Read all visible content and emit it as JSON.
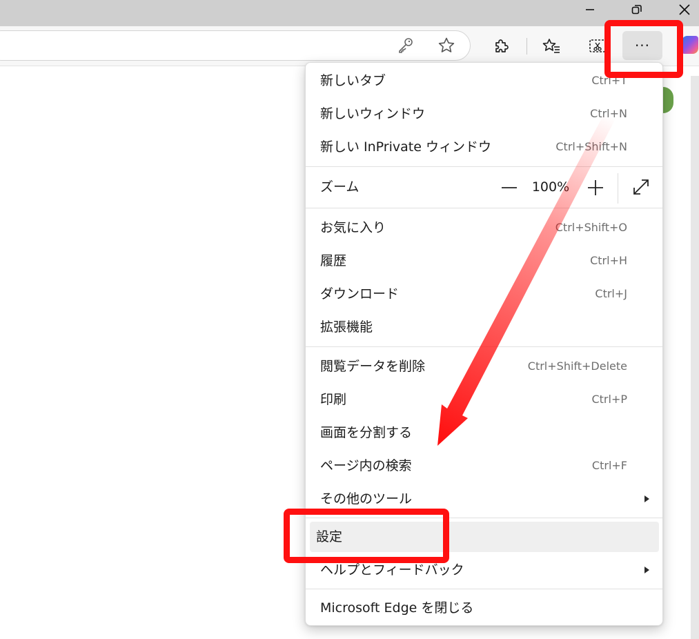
{
  "window_controls": {
    "minimize_icon": "minimize-icon",
    "restore_icon": "restore-icon",
    "close_icon": "close-icon"
  },
  "toolbar": {
    "more_label": "···",
    "icons": [
      "key-icon",
      "favorite-star-icon",
      "extensions-icon",
      "favorites-list-icon",
      "screenshot-icon",
      "copilot-icon"
    ]
  },
  "menu": {
    "group1": [
      {
        "label": "新しいタブ",
        "shortcut": "Ctrl+T"
      },
      {
        "label": "新しいウィンドウ",
        "shortcut": "Ctrl+N"
      },
      {
        "label": "新しい InPrivate ウィンドウ",
        "shortcut": "Ctrl+Shift+N"
      }
    ],
    "zoom": {
      "label": "ズーム",
      "value": "100%"
    },
    "group2": [
      {
        "label": "お気に入り",
        "shortcut": "Ctrl+Shift+O"
      },
      {
        "label": "履歴",
        "shortcut": "Ctrl+H"
      },
      {
        "label": "ダウンロード",
        "shortcut": "Ctrl+J"
      },
      {
        "label": "拡張機能",
        "shortcut": ""
      }
    ],
    "group3": [
      {
        "label": "閲覧データを削除",
        "shortcut": "Ctrl+Shift+Delete"
      },
      {
        "label": "印刷",
        "shortcut": "Ctrl+P"
      },
      {
        "label": "画面を分割する",
        "shortcut": ""
      },
      {
        "label": "ページ内の検索",
        "shortcut": "Ctrl+F"
      },
      {
        "label": "その他のツール",
        "shortcut": ""
      }
    ],
    "group4": [
      {
        "label": "設定",
        "shortcut": ""
      },
      {
        "label": "ヘルプとフィードバック",
        "shortcut": ""
      }
    ],
    "close": {
      "label": "Microsoft Edge を閉じる"
    }
  },
  "annotation": {
    "highlight_color": "#ff1010"
  }
}
